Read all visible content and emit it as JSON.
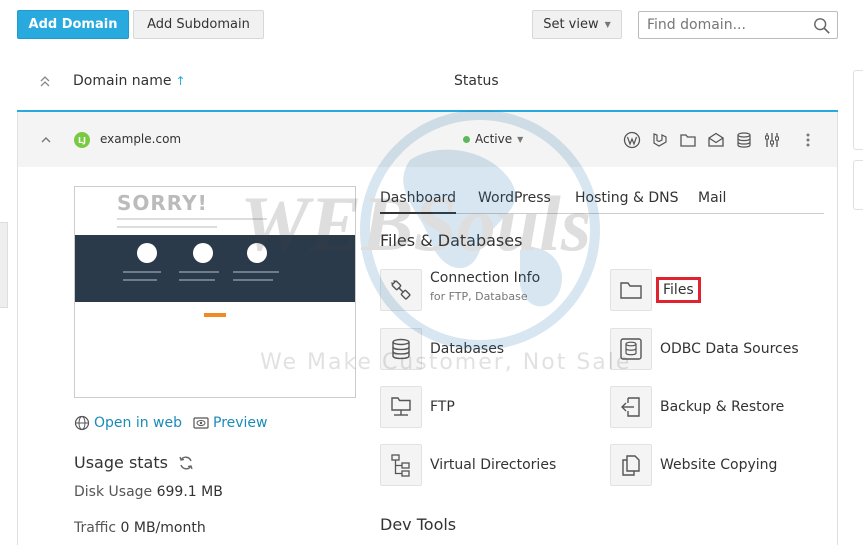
{
  "toolbar": {
    "add_domain": "Add Domain",
    "add_subdomain": "Add Subdomain",
    "set_view": "Set view",
    "search_placeholder": "Find domain..."
  },
  "list_header": {
    "domain_name": "Domain name",
    "sort_arrow": "↑",
    "status": "Status"
  },
  "domain": {
    "favicon_text": "LJ",
    "name": "example.com",
    "status": "Active",
    "thumbnail": {
      "heading": "SORRY!"
    },
    "open_in_web": "Open in web",
    "preview": "Preview",
    "usage": {
      "title": "Usage stats",
      "disk_label": "Disk Usage",
      "disk_value": "699.1 MB",
      "traffic_label": "Traffic",
      "traffic_value": "0 MB/month"
    }
  },
  "tabs": [
    "Dashboard",
    "WordPress",
    "Hosting & DNS",
    "Mail"
  ],
  "sections": {
    "files_db": "Files & Databases",
    "dev_tools": "Dev Tools"
  },
  "tools": {
    "connection_info": "Connection Info",
    "connection_info_sub": "for FTP, Database",
    "files": "Files",
    "databases": "Databases",
    "odbc": "ODBC Data Sources",
    "ftp": "FTP",
    "backup": "Backup & Restore",
    "virtual_dirs": "Virtual Directories",
    "website_copying": "Website Copying"
  },
  "watermark": {
    "brand": "WEBSouls",
    "tagline": "We Make Customer, Not Sale"
  },
  "colors": {
    "accent": "#28aade",
    "link": "#1a8bb9",
    "active_status": "#5cb85c",
    "highlight": "#e0242f"
  }
}
